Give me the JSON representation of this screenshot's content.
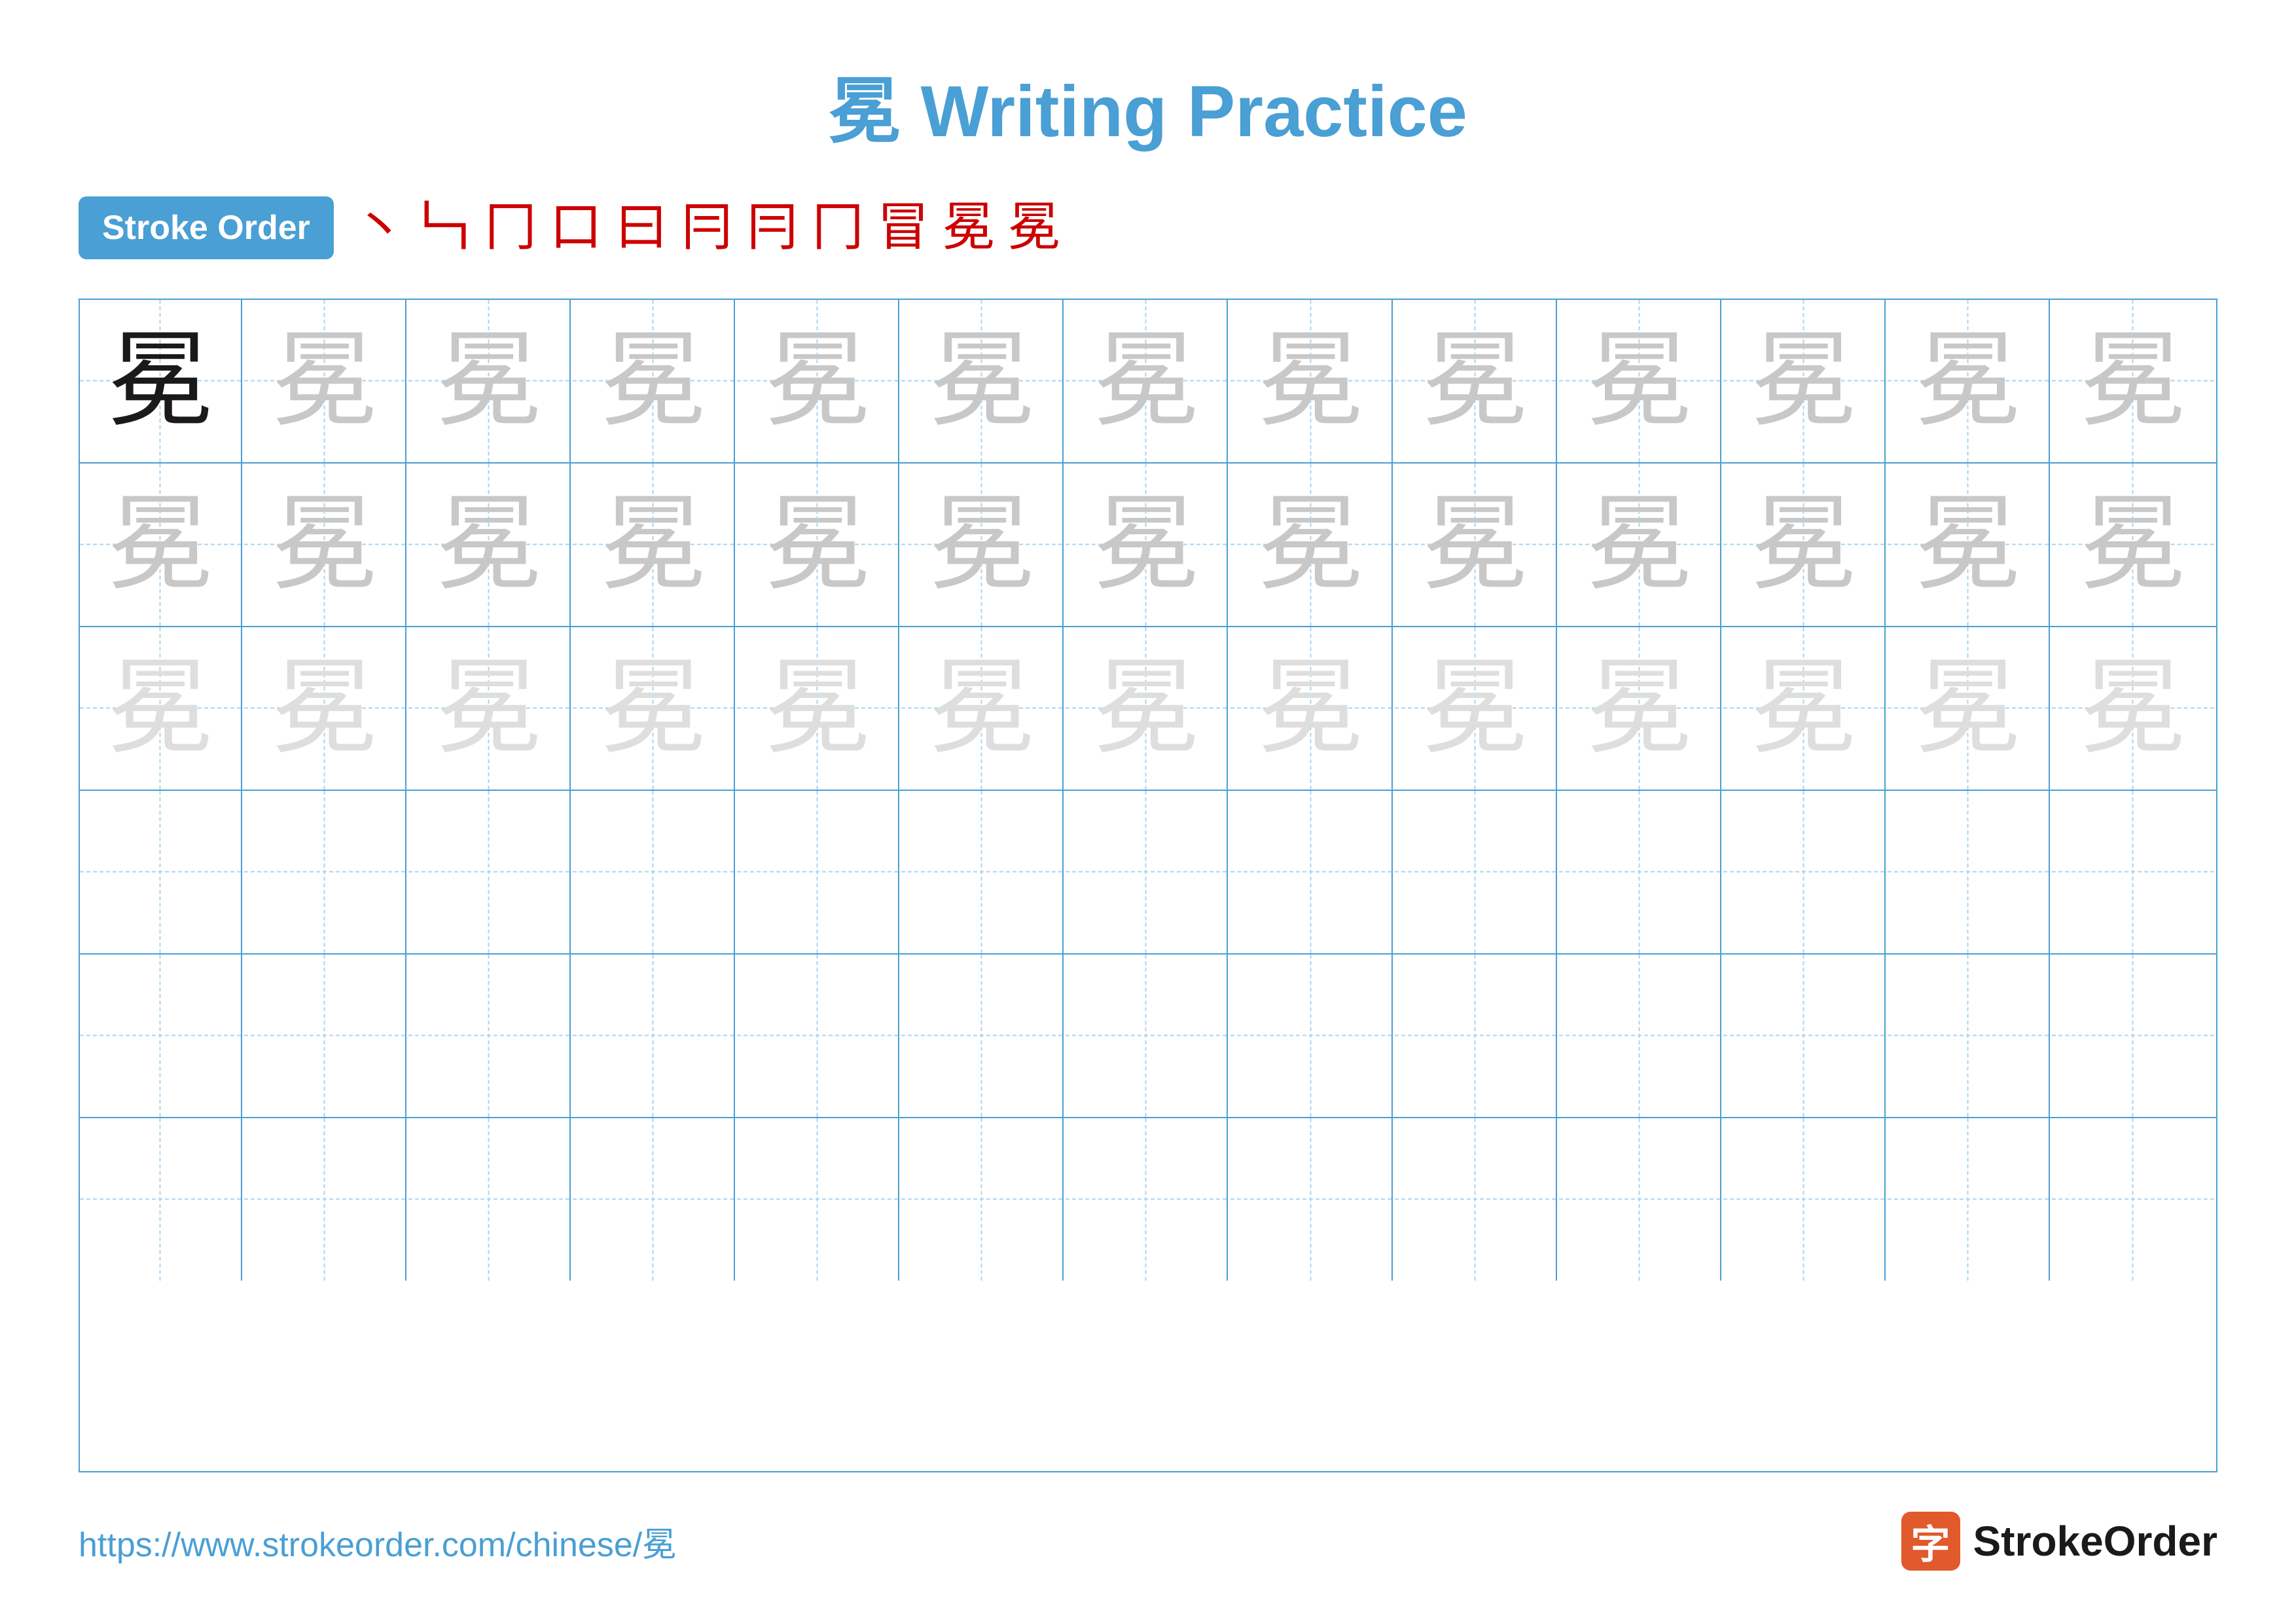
{
  "title": {
    "char": "冕",
    "label": "Writing Practice",
    "full": "冕 Writing Practice"
  },
  "stroke_order": {
    "badge_label": "Stroke Order",
    "strokes": [
      "丶",
      "㇆",
      "冂",
      "口",
      "曰",
      "冃",
      "冃",
      "冂",
      "冒",
      "冕",
      "冕"
    ]
  },
  "grid": {
    "rows": 6,
    "cols": 13,
    "char": "冕",
    "row_styles": [
      "dark",
      "medium",
      "light",
      "empty",
      "empty",
      "empty"
    ]
  },
  "footer": {
    "url": "https://www.strokeorder.com/chinese/冕",
    "logo_char": "字",
    "logo_text": "StrokeOrder"
  }
}
